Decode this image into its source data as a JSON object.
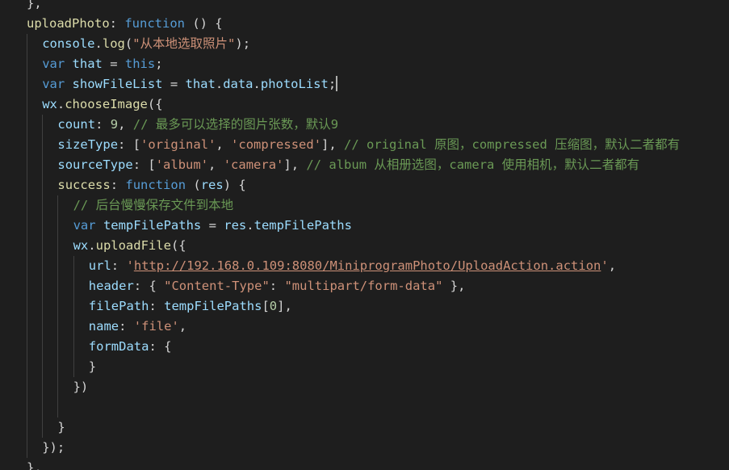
{
  "editor": {
    "theme_bg": "#1e1e1e",
    "lines": [
      {
        "indent": 0,
        "tokens": [
          {
            "t": "},",
            "c": "plain"
          }
        ]
      },
      {
        "indent": 0,
        "tokens": [
          {
            "t": "uploadPhoto",
            "c": "fn"
          },
          {
            "t": ": ",
            "c": "plain"
          },
          {
            "t": "function",
            "c": "kw"
          },
          {
            "t": " () {",
            "c": "plain"
          }
        ]
      },
      {
        "indent": 1,
        "tokens": [
          {
            "t": "console",
            "c": "prop"
          },
          {
            "t": ".",
            "c": "plain"
          },
          {
            "t": "log",
            "c": "fn"
          },
          {
            "t": "(",
            "c": "plain"
          },
          {
            "t": "\"从本地选取照片\"",
            "c": "str"
          },
          {
            "t": ");",
            "c": "plain"
          }
        ]
      },
      {
        "indent": 1,
        "tokens": [
          {
            "t": "var",
            "c": "kw"
          },
          {
            "t": " ",
            "c": "plain"
          },
          {
            "t": "that",
            "c": "prop"
          },
          {
            "t": " = ",
            "c": "plain"
          },
          {
            "t": "this",
            "c": "kw"
          },
          {
            "t": ";",
            "c": "plain"
          }
        ]
      },
      {
        "indent": 1,
        "cursor": true,
        "tokens": [
          {
            "t": "var",
            "c": "kw"
          },
          {
            "t": " ",
            "c": "plain"
          },
          {
            "t": "showFileList",
            "c": "prop"
          },
          {
            "t": " = ",
            "c": "plain"
          },
          {
            "t": "that",
            "c": "prop"
          },
          {
            "t": ".",
            "c": "plain"
          },
          {
            "t": "data",
            "c": "prop"
          },
          {
            "t": ".",
            "c": "plain"
          },
          {
            "t": "photoList",
            "c": "prop"
          },
          {
            "t": ";",
            "c": "plain"
          }
        ]
      },
      {
        "indent": 1,
        "tokens": [
          {
            "t": "wx",
            "c": "prop"
          },
          {
            "t": ".",
            "c": "plain"
          },
          {
            "t": "chooseImage",
            "c": "fn"
          },
          {
            "t": "({",
            "c": "plain"
          }
        ]
      },
      {
        "indent": 2,
        "tokens": [
          {
            "t": "count",
            "c": "prop"
          },
          {
            "t": ": ",
            "c": "plain"
          },
          {
            "t": "9",
            "c": "num"
          },
          {
            "t": ", ",
            "c": "plain"
          },
          {
            "t": "// 最多可以选择的图片张数，默认9",
            "c": "cm"
          }
        ]
      },
      {
        "indent": 2,
        "tokens": [
          {
            "t": "sizeType",
            "c": "prop"
          },
          {
            "t": ": [",
            "c": "plain"
          },
          {
            "t": "'original'",
            "c": "str"
          },
          {
            "t": ", ",
            "c": "plain"
          },
          {
            "t": "'compressed'",
            "c": "str"
          },
          {
            "t": "], ",
            "c": "plain"
          },
          {
            "t": "// original 原图，compressed 压缩图，默认二者都有",
            "c": "cm"
          }
        ]
      },
      {
        "indent": 2,
        "tokens": [
          {
            "t": "sourceType",
            "c": "prop"
          },
          {
            "t": ": [",
            "c": "plain"
          },
          {
            "t": "'album'",
            "c": "str"
          },
          {
            "t": ", ",
            "c": "plain"
          },
          {
            "t": "'camera'",
            "c": "str"
          },
          {
            "t": "], ",
            "c": "plain"
          },
          {
            "t": "// album 从相册选图，camera 使用相机，默认二者都有",
            "c": "cm"
          }
        ]
      },
      {
        "indent": 2,
        "tokens": [
          {
            "t": "success",
            "c": "fn"
          },
          {
            "t": ": ",
            "c": "plain"
          },
          {
            "t": "function",
            "c": "kw"
          },
          {
            "t": " (",
            "c": "plain"
          },
          {
            "t": "res",
            "c": "prop"
          },
          {
            "t": ") {",
            "c": "plain"
          }
        ]
      },
      {
        "indent": 3,
        "tokens": [
          {
            "t": "// 后台慢慢保存文件到本地",
            "c": "cm"
          }
        ]
      },
      {
        "indent": 3,
        "tokens": [
          {
            "t": "var",
            "c": "kw"
          },
          {
            "t": " ",
            "c": "plain"
          },
          {
            "t": "tempFilePaths",
            "c": "prop"
          },
          {
            "t": " = ",
            "c": "plain"
          },
          {
            "t": "res",
            "c": "prop"
          },
          {
            "t": ".",
            "c": "plain"
          },
          {
            "t": "tempFilePaths",
            "c": "prop"
          }
        ]
      },
      {
        "indent": 3,
        "tokens": [
          {
            "t": "wx",
            "c": "prop"
          },
          {
            "t": ".",
            "c": "plain"
          },
          {
            "t": "uploadFile",
            "c": "fn"
          },
          {
            "t": "({",
            "c": "plain"
          }
        ]
      },
      {
        "indent": 4,
        "tokens": [
          {
            "t": "url",
            "c": "prop"
          },
          {
            "t": ": ",
            "c": "plain"
          },
          {
            "t": "'",
            "c": "str"
          },
          {
            "t": "http://192.168.0.109:8080/MiniprogramPhoto/UploadAction.action",
            "c": "str url"
          },
          {
            "t": "'",
            "c": "str"
          },
          {
            "t": ",",
            "c": "plain"
          }
        ]
      },
      {
        "indent": 4,
        "tokens": [
          {
            "t": "header",
            "c": "prop"
          },
          {
            "t": ": { ",
            "c": "plain"
          },
          {
            "t": "\"Content-Type\"",
            "c": "str"
          },
          {
            "t": ": ",
            "c": "plain"
          },
          {
            "t": "\"multipart/form-data\"",
            "c": "str"
          },
          {
            "t": " },",
            "c": "plain"
          }
        ]
      },
      {
        "indent": 4,
        "tokens": [
          {
            "t": "filePath",
            "c": "prop"
          },
          {
            "t": ": ",
            "c": "plain"
          },
          {
            "t": "tempFilePaths",
            "c": "prop"
          },
          {
            "t": "[",
            "c": "plain"
          },
          {
            "t": "0",
            "c": "num"
          },
          {
            "t": "],",
            "c": "plain"
          }
        ]
      },
      {
        "indent": 4,
        "tokens": [
          {
            "t": "name",
            "c": "prop"
          },
          {
            "t": ": ",
            "c": "plain"
          },
          {
            "t": "'file'",
            "c": "str"
          },
          {
            "t": ",",
            "c": "plain"
          }
        ]
      },
      {
        "indent": 4,
        "tokens": [
          {
            "t": "formData",
            "c": "prop"
          },
          {
            "t": ": {",
            "c": "plain"
          }
        ]
      },
      {
        "indent": 4,
        "tokens": [
          {
            "t": "}",
            "c": "plain"
          }
        ]
      },
      {
        "indent": 3,
        "tokens": [
          {
            "t": "})",
            "c": "plain"
          }
        ]
      },
      {
        "indent": 3,
        "tokens": []
      },
      {
        "indent": 2,
        "tokens": [
          {
            "t": "}",
            "c": "plain"
          }
        ]
      },
      {
        "indent": 1,
        "tokens": [
          {
            "t": "});",
            "c": "plain"
          }
        ]
      },
      {
        "indent": 0,
        "tokens": [
          {
            "t": "},",
            "c": "plain"
          }
        ]
      }
    ]
  }
}
